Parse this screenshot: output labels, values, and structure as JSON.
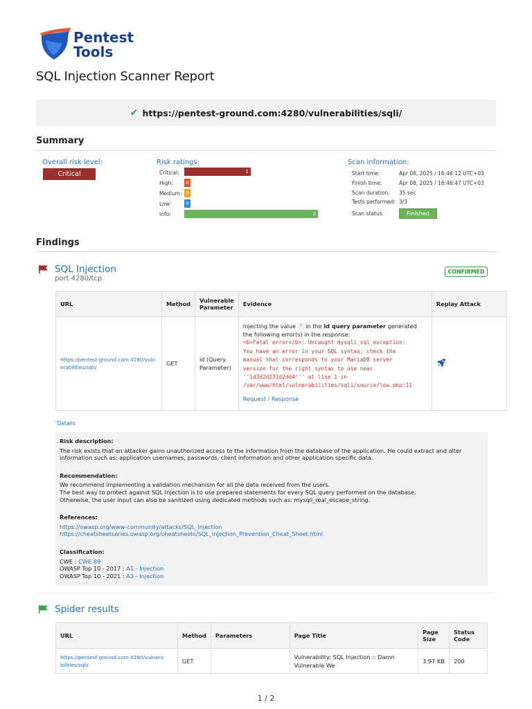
{
  "brand": {
    "line1": "Pentest",
    "line2": "Tools"
  },
  "report_title": "SQL Injection Scanner Report",
  "target_url": "https://pentest-ground.com:4280/vulnerabilities/sqli/",
  "summary": {
    "heading": "Summary",
    "overall_label": "Overall risk level:",
    "overall_value": "Critical",
    "ratings_label": "Risk ratings:",
    "ratings": [
      {
        "name": "Critical:",
        "count": "1",
        "color": "#9c2e2e"
      },
      {
        "name": "High:",
        "count": "0",
        "color": "#e0562b"
      },
      {
        "name": "Medium:",
        "count": "0",
        "color": "#f39c33"
      },
      {
        "name": "Low:",
        "count": "0",
        "color": "#3a86c8"
      },
      {
        "name": "Info:",
        "count": "2",
        "color": "#6cb45b"
      }
    ],
    "scan_info_label": "Scan information:",
    "scan_info": [
      {
        "key": "Start time:",
        "value": "Apr 08, 2025 / 16:46:12 UTC+03"
      },
      {
        "key": "Finish time:",
        "value": "Apr 08, 2025 / 16:46:47 UTC+03"
      },
      {
        "key": "Scan duration:",
        "value": "35 sec"
      },
      {
        "key": "Tests performed:",
        "value": "3/3"
      }
    ],
    "scan_status_key": "Scan status:",
    "scan_status_value": "Finished"
  },
  "findings": {
    "heading": "Findings",
    "title": "SQL Injection",
    "port": "port 4280/tcp",
    "badge": "CONFIRMED",
    "columns": [
      "URL",
      "Method",
      "Vulnerable Parameter",
      "Evidence",
      "Replay Attack"
    ],
    "row": {
      "url": "https://pentest-ground.com:4280/vulnerabilities/sqli/",
      "method": "GET",
      "param": "id (Query Parameter)",
      "evidence_pre": "Injecting the value",
      "evidence_value": "'",
      "evidence_mid": "in the",
      "evidence_param": "id query parameter",
      "evidence_post": "generated the following error(s) in the response:",
      "error_lines": [
        "<b>Fatal error</b>: Uncaught mysqli_sql_exception:",
        "You have an error in your SQL syntax; check the",
        "manual that corresponds to your MariaDB server",
        "version for the right syntax to use near",
        "''1d3d2d231d2dd4''' at line 1 in",
        "/var/www/html/vulnerabilities/sqli/source/low.php:11"
      ],
      "request_link": "Request / Response"
    },
    "details_toggle": "Details",
    "risk_desc_title": "Risk description:",
    "risk_desc": "The risk exists that an attacker gains unauthorized access to the information from the database of the application. He could extract and alter information such as: application usernames, passwords, client information and other application specific data.",
    "recommendation_title": "Recommendation:",
    "recommendation": [
      "We recommend implementing a validation mechanism for all the data received from the users.",
      "The best way to protect against SQL Injection is to use prepared statements for every SQL query performed on the database.",
      "Otherwise, the user input can also be sanitized using dedicated methods such as: mysqli_real_escape_string."
    ],
    "references_title": "References:",
    "references": [
      "https://owasp.org/www-community/attacks/SQL_Injection",
      "https://cheatsheetseries.owasp.org/cheatsheets/SQL_Injection_Prevention_Cheat_Sheet.html"
    ],
    "classification_title": "Classification:",
    "classification": [
      {
        "label": "CWE : ",
        "link": "CWE-89"
      },
      {
        "label": "OWASP Top 10 - 2017 : ",
        "link": "A1 - Injection"
      },
      {
        "label": "OWASP Top 10 - 2021 : ",
        "link": "A3 - Injection"
      }
    ]
  },
  "spider": {
    "title": "Spider results",
    "columns": [
      "URL",
      "Method",
      "Parameters",
      "Page Title",
      "Page Size",
      "Status Code"
    ],
    "row": {
      "url": "https://pentest-ground.com:4280/vulnerabilities/sqli/",
      "method": "GET",
      "parameters": "",
      "page_title": "Vulnerability: SQL Injection :: Damn Vulnerable We",
      "page_size": "3.97 KB",
      "status": "200"
    }
  },
  "page_number": "1 / 2"
}
